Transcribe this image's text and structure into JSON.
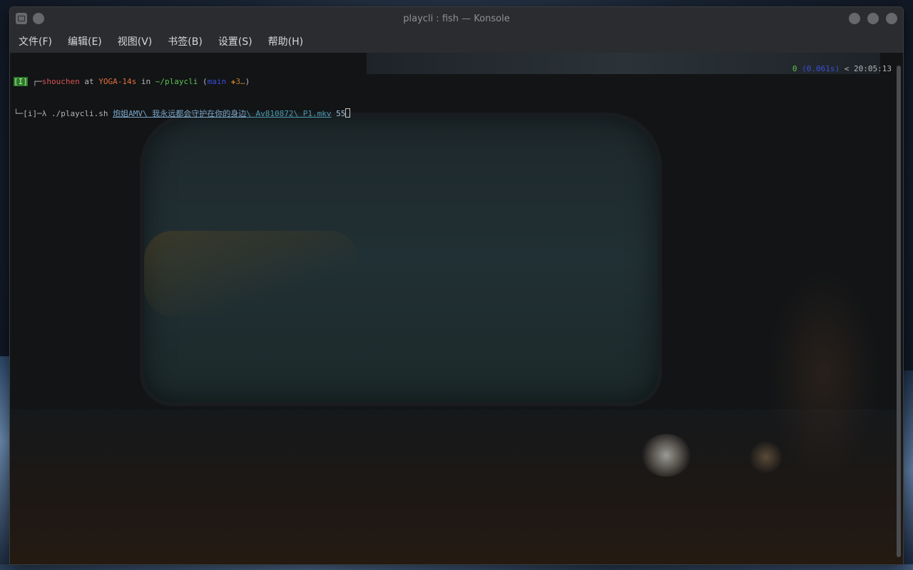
{
  "window": {
    "title": "playcli : fish — Konsole"
  },
  "menu": {
    "items": [
      {
        "label": "文件(F)"
      },
      {
        "label": "编辑(E)"
      },
      {
        "label": "视图(V)"
      },
      {
        "label": "书签(B)"
      },
      {
        "label": "设置(S)"
      },
      {
        "label": "帮助(H)"
      }
    ]
  },
  "terminal": {
    "line1": {
      "mode": "[I]",
      "corner": "┌─",
      "user": "shouchen",
      "at": " at ",
      "host": "YOGA-14s",
      "in": " in ",
      "path": "~/playcli",
      "open_paren": " (",
      "branch": "main",
      "git_status": " ✚3…",
      "close_paren": ")"
    },
    "line2": {
      "corner": "└─",
      "mode": "[i]",
      "lambda": "─λ ",
      "command": "./playcli.sh",
      "space": " ",
      "arg1_a": "炮姐AMV\\ 我永远都会守护在你的身边",
      "arg1_b": "\\ Av810872\\ P1.mkv",
      "arg2": " 55"
    },
    "right_prompt": {
      "status": "0",
      "duration": " (0.061s)",
      "time": " < 20:05:13"
    }
  },
  "colors": {
    "mode_bg": "#2a7a2a",
    "user": "#d9534f",
    "host": "#e2713a",
    "path": "#5ec24f",
    "branch": "#3a4fd8",
    "git_status": "#c17a2c"
  }
}
